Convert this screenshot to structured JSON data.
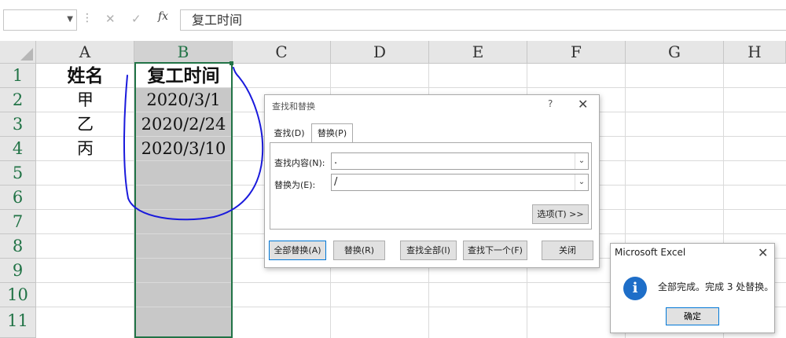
{
  "formula_bar": {
    "name_box": "",
    "cancel_symbol": "✕",
    "enter_symbol": "✓",
    "fx_label": "fx",
    "content": "复工时间"
  },
  "columns": [
    "A",
    "B",
    "C",
    "D",
    "E",
    "F",
    "G",
    "H"
  ],
  "selected_column": "B",
  "rows": [
    "1",
    "2",
    "3",
    "4",
    "5",
    "6",
    "7",
    "8",
    "9",
    "10",
    "11"
  ],
  "cells": {
    "A1": "姓名",
    "B1": "复工时间",
    "A2": "甲",
    "B2": "2020/3/1",
    "A3": "乙",
    "B3": "2020/2/24",
    "A4": "丙",
    "B4": "2020/3/10"
  },
  "find_replace_dialog": {
    "title": "查找和替换",
    "help": "?",
    "close": "✕",
    "tabs": [
      {
        "label": "查找(D)",
        "active": false
      },
      {
        "label": "替换(P)",
        "active": true
      }
    ],
    "find_label": "查找内容(N):",
    "find_value": ".",
    "replace_label": "替换为(E):",
    "replace_value": "/",
    "options_button": "选项(T) >>",
    "buttons": {
      "replace_all": "全部替换(A)",
      "replace": "替换(R)",
      "find_all": "查找全部(I)",
      "find_next": "查找下一个(F)",
      "close": "关闭"
    }
  },
  "message_box": {
    "title": "Microsoft Excel",
    "close": "✕",
    "icon": "information-icon",
    "text": "全部完成。完成 3 处替换。",
    "ok_label": "确定"
  },
  "colors": {
    "excel_green": "#217346",
    "annotation_ink": "#1a1adc",
    "selection_fill": "#c8c8c8",
    "primary_button_border": "#0078d7"
  }
}
